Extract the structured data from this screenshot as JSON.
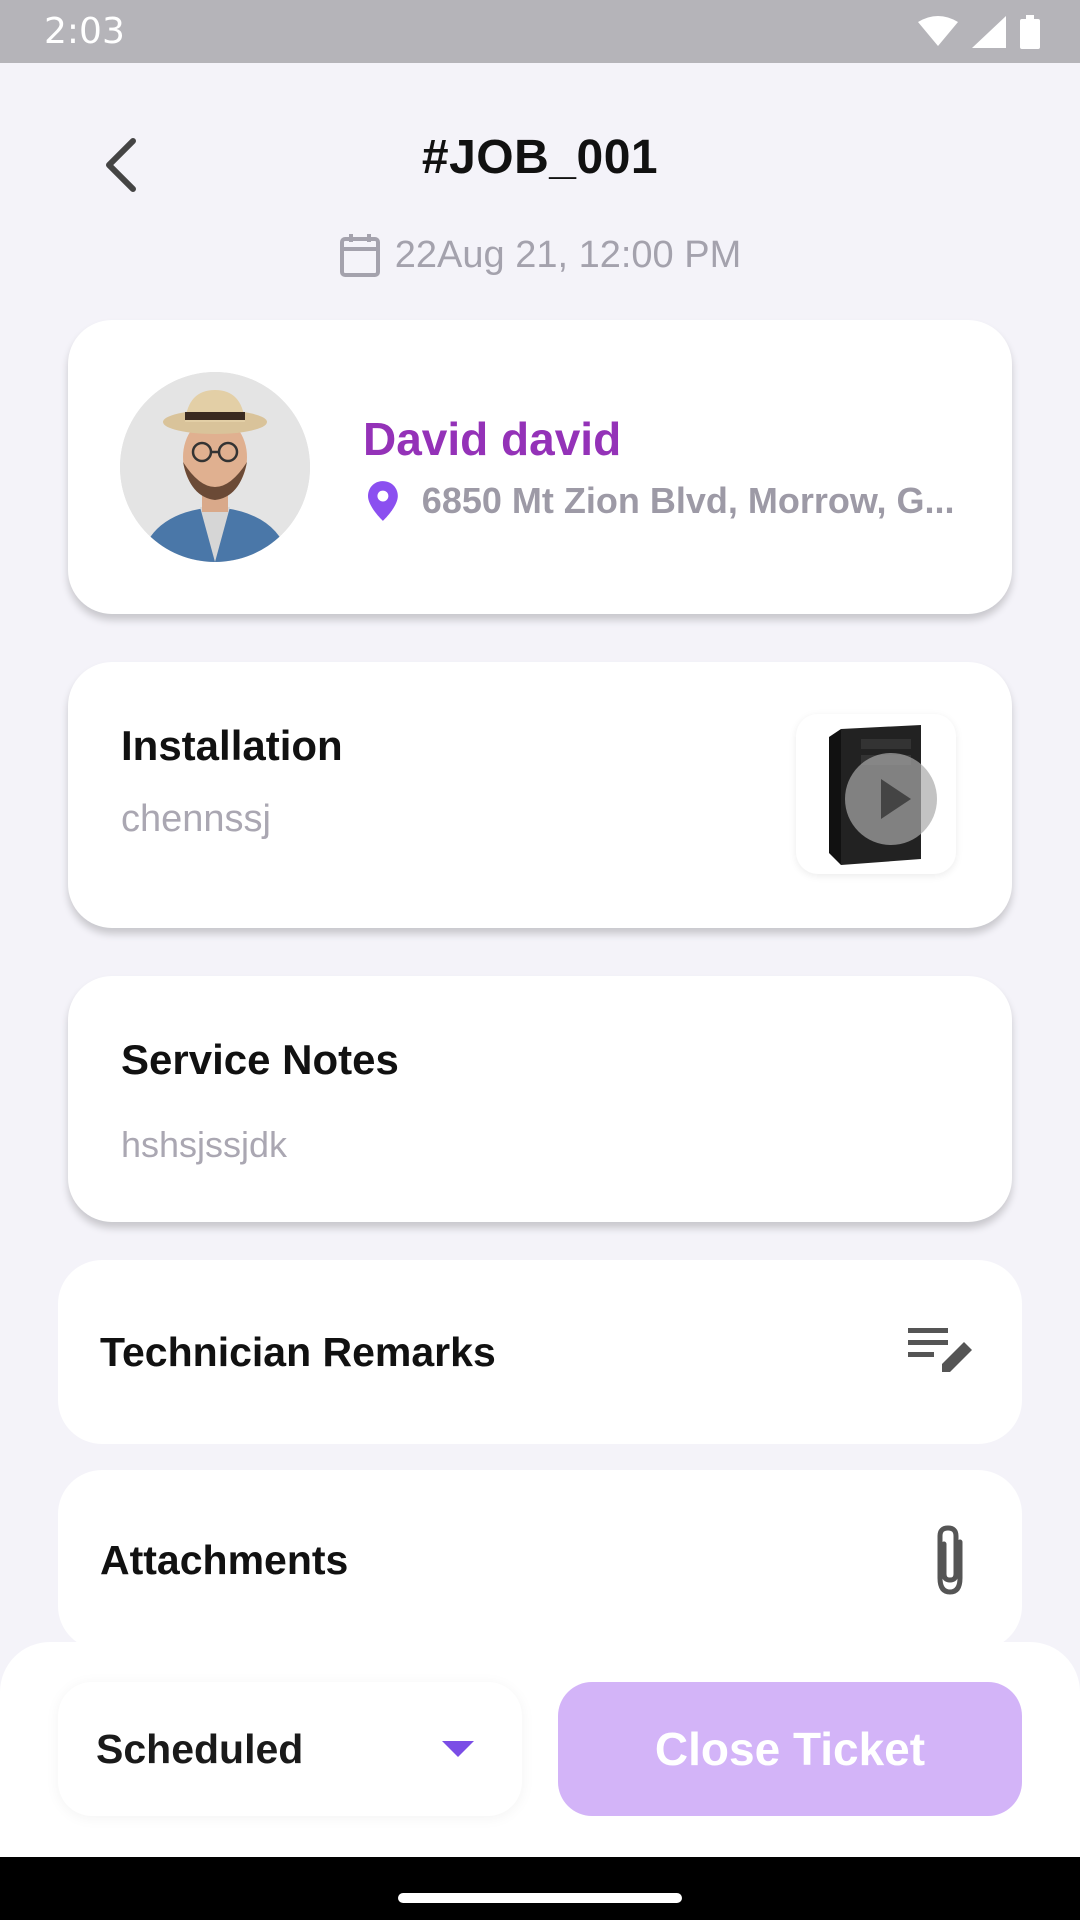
{
  "status_bar": {
    "time": "2:03"
  },
  "header": {
    "title": "#JOB_001",
    "date": "22Aug 21, 12:00 PM"
  },
  "customer": {
    "name": "David david",
    "address": "6850 Mt Zion Blvd, Morrow, G..."
  },
  "service": {
    "title": "Installation",
    "subtitle": "chennssj"
  },
  "notes": {
    "title": "Service Notes",
    "text": "hshsjssjdk"
  },
  "remarks": {
    "label": "Technician Remarks"
  },
  "attachments": {
    "label": "Attachments"
  },
  "footer": {
    "status_value": "Scheduled",
    "close_label": "Close Ticket"
  },
  "colors": {
    "accent": "#9432b8",
    "pin": "#8b4ff0",
    "dropdown_arrow": "#7b4de6",
    "close_button": "#d3b4f8"
  }
}
